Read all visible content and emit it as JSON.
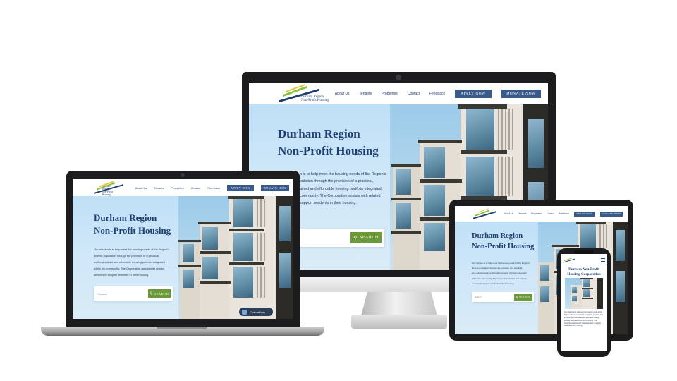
{
  "site": {
    "logo_line1": "Durham Region",
    "logo_line2": "Non-Profit Housing",
    "nav": [
      "About Us",
      "Tenants",
      "Properties",
      "Contact",
      "Feedback"
    ],
    "apply_label": "APPLY NOW",
    "donate_label": "DONATE NOW",
    "hero_title_line1": "Durham Region",
    "hero_title_line2": "Non-Profit Housing",
    "mobile_title": "Durham Non-Profit Housing Corporation",
    "mission_lines": [
      "Our mission is to help meet the housing needs of the Region's",
      "diverse population through the provision of a practical,",
      "well-maintained and affordable housing portfolio integrated",
      "within the community.  The Corporation assists with related",
      "services to support residents in their housing."
    ],
    "monitor_mission_lines": [
      "n is to help meet the housing needs of the Region's",
      "pulation through the provision of a practical,",
      "ained and affordable housing portfolio integrated",
      "community.  The Corporation assists with related",
      "support residents in their housing."
    ],
    "search_placeholder": "Search",
    "search_label": "SEARCH",
    "chat_label": "Chat with us"
  },
  "colors": {
    "brand_navy": "#1f3f73",
    "button_blue": "#3a5a8c",
    "search_green": "#6a9a3a",
    "logo_green": "#8bbf3f",
    "logo_yellow": "#e3c33a"
  },
  "icons": [
    "search-icon",
    "chat-icon",
    "hamburger-menu-icon",
    "camera-icon"
  ]
}
